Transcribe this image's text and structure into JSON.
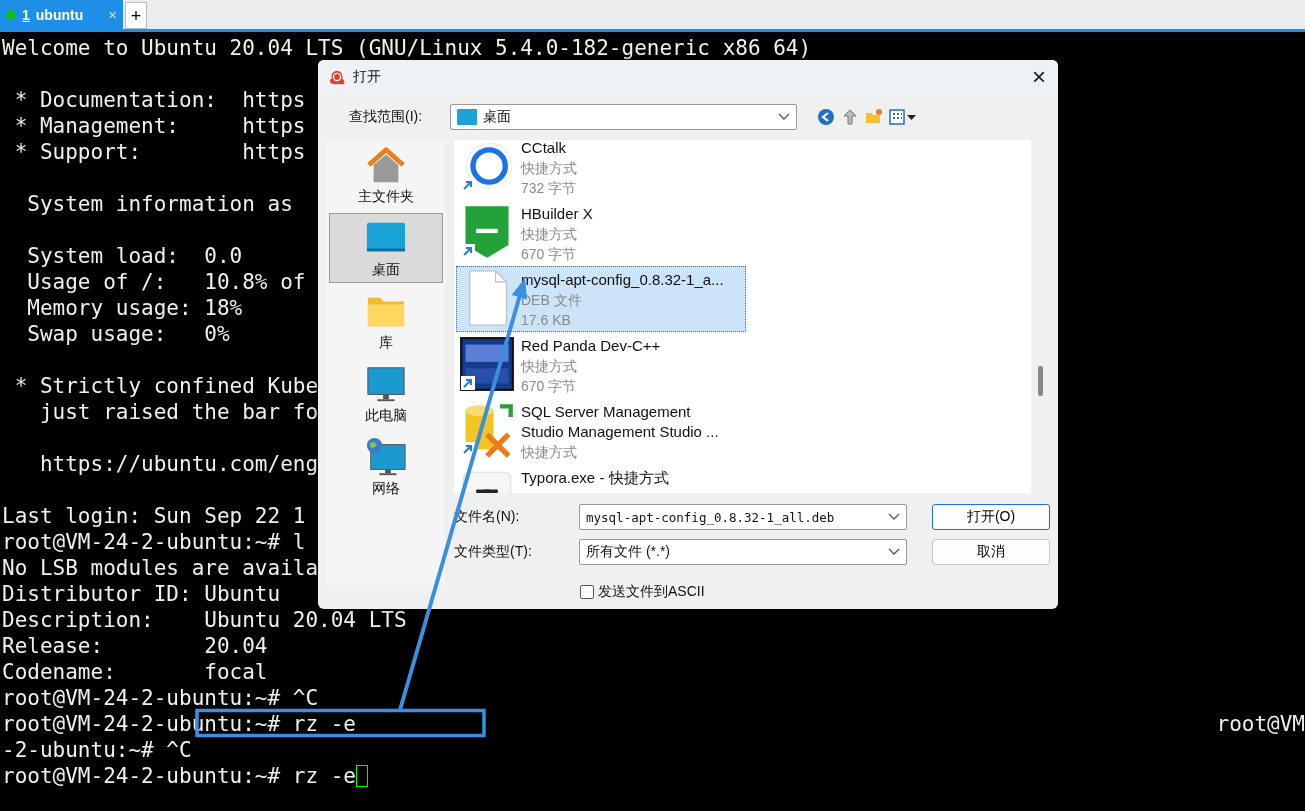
{
  "tabs": [
    {
      "number": "1",
      "label": "ubuntu",
      "selected": true,
      "close": "×"
    }
  ],
  "new_tab": "+",
  "terminal": {
    "lines": [
      {
        "kind": "text",
        "text": "Welcome to Ubuntu 20.04 LTS (GNU/Linux 5.4.0-182-generic x86 64)"
      },
      {
        "kind": "blank"
      },
      {
        "kind": "text",
        "text": " * Documentation:  https"
      },
      {
        "kind": "text",
        "text": " * Management:     https"
      },
      {
        "kind": "text",
        "text": " * Support:        https"
      },
      {
        "kind": "blank"
      },
      {
        "kind": "text",
        "text": "  System information as"
      },
      {
        "kind": "blank"
      },
      {
        "kind": "text",
        "text": "  System load:  0.0"
      },
      {
        "kind": "text",
        "text": "  Usage of /:   10.8% of"
      },
      {
        "kind": "text",
        "text": "  Memory usage: 18%"
      },
      {
        "kind": "text",
        "text": "  Swap usage:   0%"
      },
      {
        "kind": "blank"
      },
      {
        "kind": "text",
        "text": " * Strictly confined Kube"
      },
      {
        "kind": "text",
        "text": "   just raised the bar fo"
      },
      {
        "kind": "blank"
      },
      {
        "kind": "text",
        "text": "   https://ubuntu.com/eng"
      },
      {
        "kind": "blank"
      },
      {
        "kind": "text",
        "text": "Last login: Sun Sep 22 1"
      },
      {
        "kind": "text",
        "text": "root@VM-24-2-ubuntu:~# l"
      },
      {
        "kind": "text",
        "text": "No LSB modules are availa"
      },
      {
        "kind": "text",
        "text": "Distributor ID: Ubuntu"
      },
      {
        "kind": "text",
        "text": "Description:    Ubuntu 20.04 LTS"
      },
      {
        "kind": "text",
        "text": "Release:        20.04"
      },
      {
        "kind": "text",
        "text": "Codename:       focal"
      },
      {
        "kind": "text",
        "text": "root@VM-24-2-ubuntu:~# ^C"
      },
      {
        "kind": "text",
        "text": "root@VM-24-2-ubuntu:~# rz -e",
        "right": "root@VM"
      },
      {
        "kind": "text",
        "text": "-2-ubuntu:~# ^C"
      },
      {
        "kind": "text",
        "text": "root@VM-24-2-ubuntu:~# rz -e",
        "cursor": true
      }
    ]
  },
  "dialog": {
    "title": "打开",
    "close": "×",
    "look_in": {
      "label": "查找范围(I):",
      "value": "桌面"
    },
    "places": [
      {
        "label": "主文件夹",
        "kind": "home",
        "selected": false
      },
      {
        "label": "桌面",
        "kind": "desktop",
        "selected": true
      },
      {
        "label": "库",
        "kind": "library",
        "selected": false
      },
      {
        "label": "此电脑",
        "kind": "computer",
        "selected": false
      },
      {
        "label": "网络",
        "kind": "network",
        "selected": false
      }
    ],
    "files": [
      {
        "name": "CCtalk",
        "type": "快捷方式",
        "size": "732 字节",
        "kind": "app",
        "shortcut": true,
        "selected": false
      },
      {
        "name": "HBuilder X",
        "type": "快捷方式",
        "size": "670 字节",
        "kind": "app",
        "shortcut": true,
        "selected": false
      },
      {
        "name": "mysql-apt-config_0.8.32-1_a...",
        "type": "DEB 文件",
        "size": "17.6 KB",
        "kind": "file",
        "shortcut": false,
        "selected": true
      },
      {
        "name": "Red Panda Dev-C++",
        "type": "快捷方式",
        "size": "670 字节",
        "kind": "app",
        "shortcut": true,
        "selected": false
      },
      {
        "name": "SQL Server Management\nStudio Management Studio ...",
        "type": "快捷方式",
        "kind": "app",
        "shortcut": true,
        "selected": false
      },
      {
        "name": "Typora.exe - 快捷方式",
        "kind": "app",
        "shortcut": false,
        "selected": false
      }
    ],
    "file_name": {
      "label": "文件名(N):",
      "value": "mysql-apt-config_0.8.32-1_all.deb"
    },
    "file_type": {
      "label": "文件类型(T):",
      "value": "所有文件 (*.*)"
    },
    "buttons": [
      "打开(O)",
      "取消"
    ],
    "ascii": {
      "label": "发送文件到ASCII",
      "checked": false
    }
  }
}
